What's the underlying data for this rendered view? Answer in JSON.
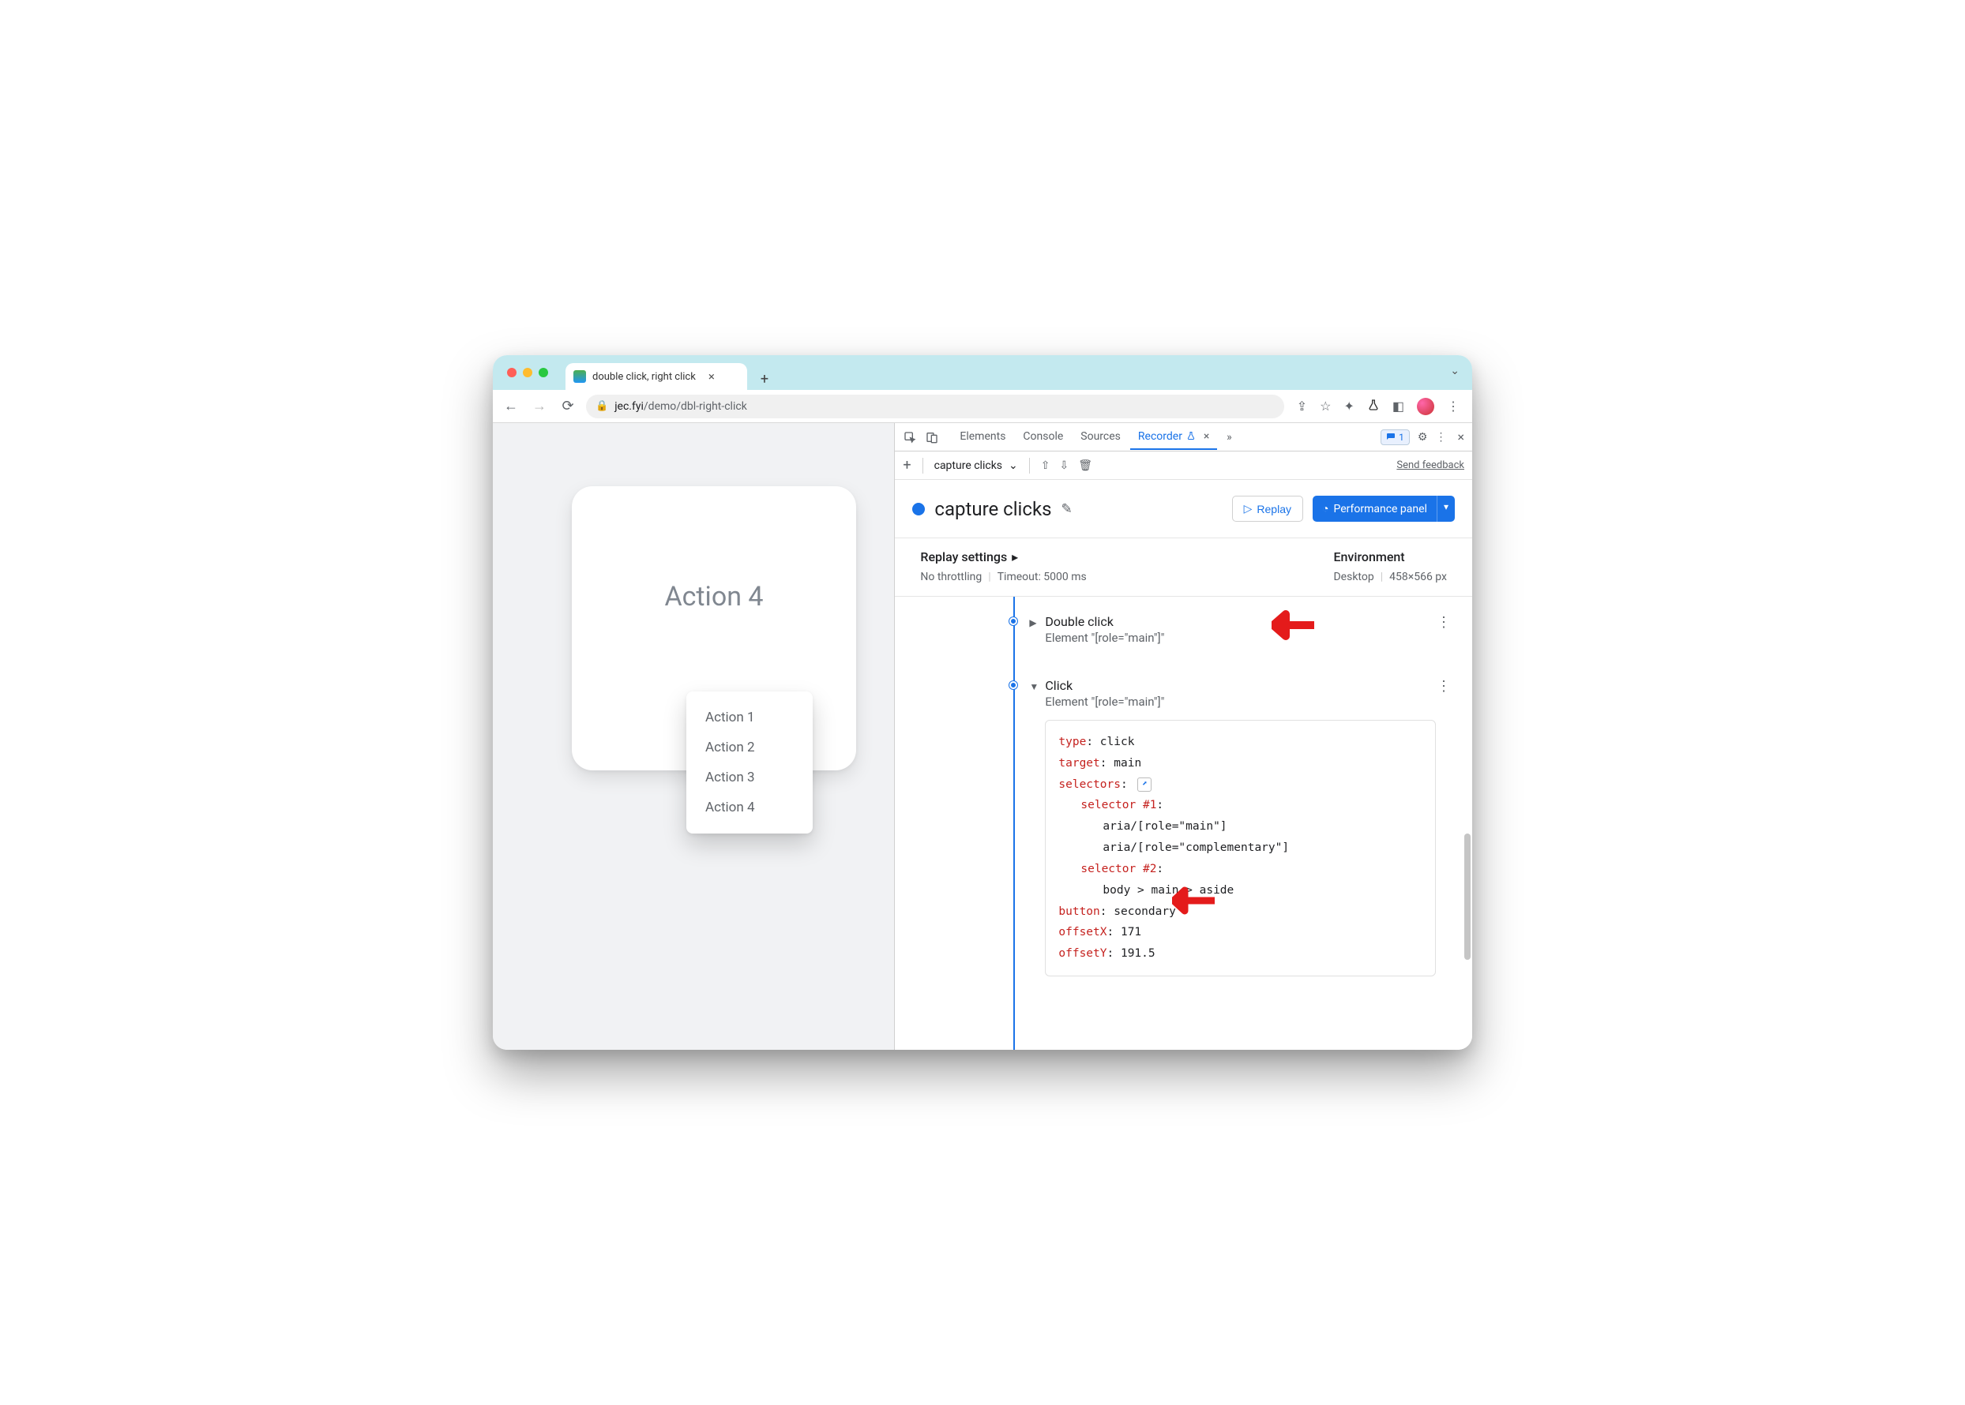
{
  "tab": {
    "title": "double click, right click"
  },
  "url": {
    "domain": "jec.fyi",
    "path": "/demo/dbl-right-click"
  },
  "devtools_tabs": {
    "elements": "Elements",
    "console": "Console",
    "sources": "Sources",
    "recorder": "Recorder",
    "issues_count": "1"
  },
  "recorder_toolbar": {
    "recording_name": "capture clicks",
    "feedback": "Send feedback"
  },
  "recording": {
    "title": "capture clicks",
    "replay_btn": "Replay",
    "perf_btn": "Performance panel"
  },
  "settings": {
    "replay_label": "Replay settings",
    "throttling": "No throttling",
    "timeout": "Timeout: 5000 ms",
    "env_label": "Environment",
    "env_device": "Desktop",
    "env_size": "458×566 px"
  },
  "page": {
    "card_title": "Action 4",
    "menu": [
      "Action 1",
      "Action 2",
      "Action 3",
      "Action 4"
    ]
  },
  "steps": [
    {
      "title": "Double click",
      "subtitle": "Element \"[role=\"main\"]\""
    },
    {
      "title": "Click",
      "subtitle": "Element \"[role=\"main\"]\"",
      "details": {
        "type_k": "type",
        "type_v": "click",
        "target_k": "target",
        "target_v": "main",
        "selectors_k": "selectors",
        "sel1_k": "selector #1",
        "sel1_a": "aria/[role=\"main\"]",
        "sel1_b": "aria/[role=\"complementary\"]",
        "sel2_k": "selector #2",
        "sel2_a": "body > main > aside",
        "button_k": "button",
        "button_v": "secondary",
        "offx_k": "offsetX",
        "offx_v": "171",
        "offy_k": "offsetY",
        "offy_v": "191.5"
      }
    }
  ]
}
